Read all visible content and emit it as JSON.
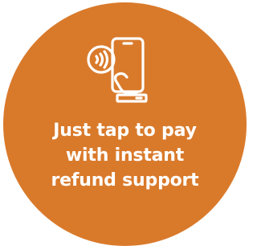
{
  "badge": {
    "color": "#d97a2b",
    "icon": "tap-to-pay-phone-icon",
    "text_color": "#ffffff",
    "lines": [
      "Just tap to pay",
      "with instant",
      "refund support"
    ]
  }
}
